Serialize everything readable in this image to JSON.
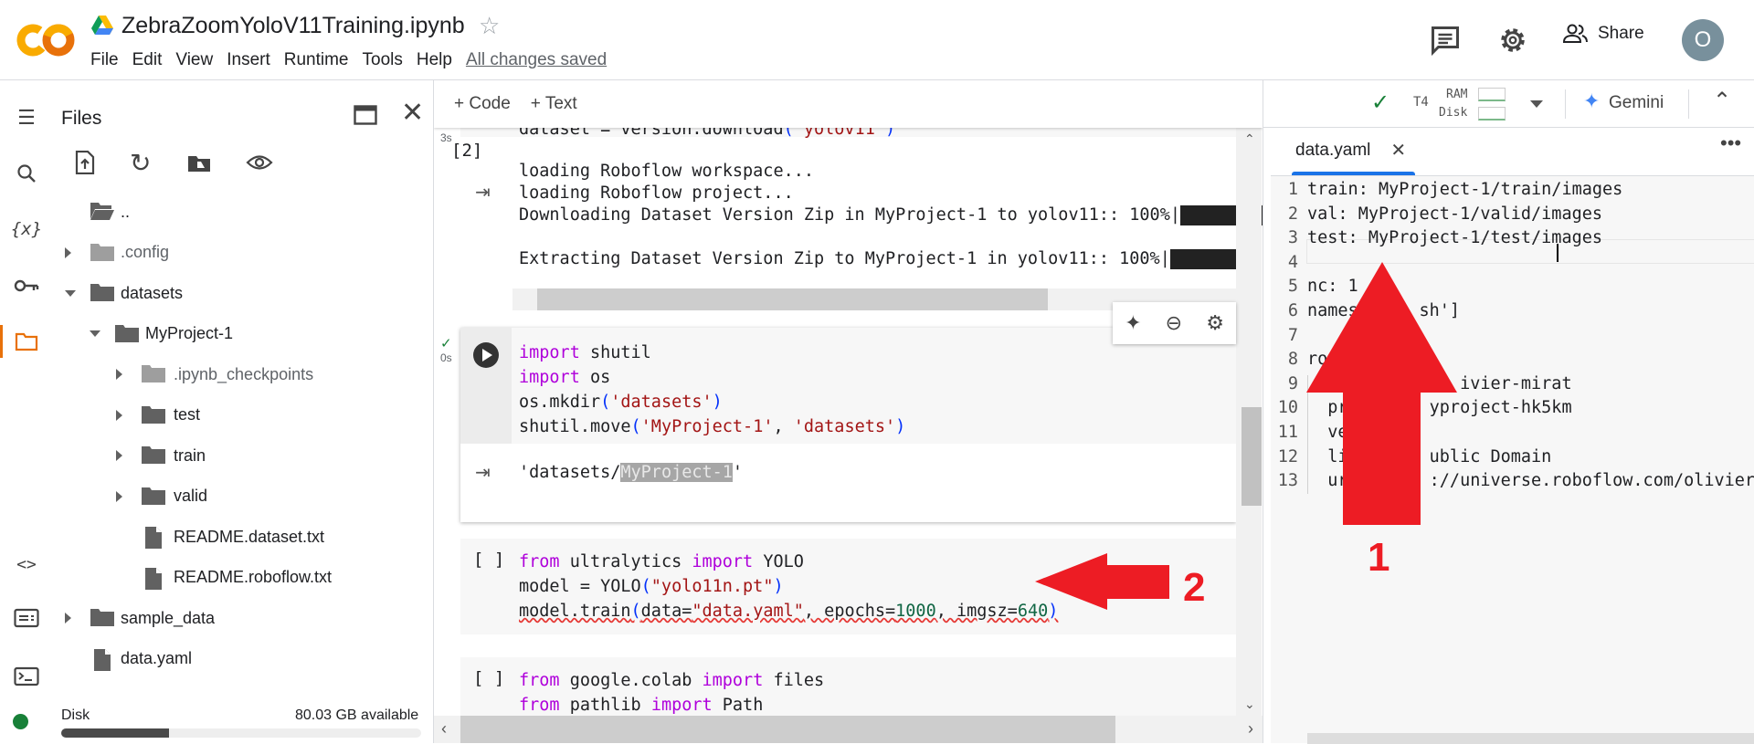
{
  "header": {
    "title": "ZebraZoomYoloV11Training.ipynb",
    "menu": [
      "File",
      "Edit",
      "View",
      "Insert",
      "Runtime",
      "Tools",
      "Help"
    ],
    "save_status": "All changes saved",
    "share_label": "Share",
    "avatar_initial": "O"
  },
  "rail": {
    "icons": [
      "toc-icon",
      "search-icon",
      "variables-icon",
      "key-icon",
      "folder-icon",
      "code-snippets-icon",
      "command-palette-icon",
      "terminal-icon"
    ],
    "active": "folder-icon"
  },
  "files": {
    "title": "Files",
    "tree": [
      {
        "label": "..",
        "level": 0,
        "kind": "folder-open"
      },
      {
        "label": ".config",
        "level": 0,
        "kind": "folder",
        "chevron": "right",
        "hidden": true
      },
      {
        "label": "datasets",
        "level": 0,
        "kind": "folder",
        "chevron": "down"
      },
      {
        "label": "MyProject-1",
        "level": 1,
        "kind": "folder",
        "chevron": "down"
      },
      {
        "label": ".ipynb_checkpoints",
        "level": 2,
        "kind": "folder",
        "chevron": "right",
        "hidden": true
      },
      {
        "label": "test",
        "level": 2,
        "kind": "folder",
        "chevron": "right"
      },
      {
        "label": "train",
        "level": 2,
        "kind": "folder",
        "chevron": "right"
      },
      {
        "label": "valid",
        "level": 2,
        "kind": "folder",
        "chevron": "right"
      },
      {
        "label": "README.dataset.txt",
        "level": 2,
        "kind": "file"
      },
      {
        "label": "README.roboflow.txt",
        "level": 2,
        "kind": "file"
      },
      {
        "label": "sample_data",
        "level": 0,
        "kind": "folder",
        "chevron": "right"
      },
      {
        "label": "data.yaml",
        "level": 0,
        "kind": "file"
      }
    ],
    "disk_label": "Disk",
    "disk_available": "80.03 GB available",
    "disk_used_fraction": 0.3
  },
  "toolbar": {
    "add_code": "+ Code",
    "add_text": "+ Text",
    "runtime": "T4",
    "ram_label": "RAM",
    "disk_label": "Disk",
    "gemini_label": "Gemini",
    "status_color": "#188038"
  },
  "cells": [
    {
      "exec": "[2]",
      "time": "3s",
      "status": "done",
      "code": [
        [
          [
            "dataset = version.download",
            ""
          ],
          [
            "(",
            "par"
          ],
          [
            "\"yolov11\"",
            "str"
          ],
          [
            ")",
            "par"
          ]
        ]
      ],
      "output": [
        "loading Roboflow workspace...",
        "loading Roboflow project...",
        "Downloading Dataset Version Zip in MyProject-1 to yolov11:: 100%|",
        "",
        "Extracting Dataset Version Zip to MyProject-1 in yolov11:: 100%|"
      ]
    },
    {
      "exec": "",
      "time": "0s",
      "status": "done",
      "code": [
        [
          [
            "import",
            "kw"
          ],
          [
            " shutil",
            ""
          ]
        ],
        [
          [
            "import",
            "kw"
          ],
          [
            " os",
            ""
          ]
        ],
        [
          [
            "os.mkdir",
            ""
          ],
          [
            "(",
            "par"
          ],
          [
            "'datasets'",
            "str"
          ],
          [
            ")",
            "par"
          ]
        ],
        [
          [
            "shutil.move",
            ""
          ],
          [
            "(",
            "par"
          ],
          [
            "'MyProject-1'",
            "str"
          ],
          [
            ", ",
            ""
          ],
          [
            "'datasets'",
            "str"
          ],
          [
            ")",
            "par"
          ]
        ]
      ],
      "output_prefix": "'datasets/",
      "output_selected": "MyProject-1",
      "output_suffix": "'"
    },
    {
      "exec": "[ ]",
      "code": [
        [
          [
            "from",
            "kw"
          ],
          [
            " ultralytics ",
            ""
          ],
          [
            "import",
            "kw"
          ],
          [
            " YOLO",
            ""
          ]
        ],
        [
          [
            "model = YOLO",
            ""
          ],
          [
            "(",
            "par"
          ],
          [
            "\"yolo11n.pt\"",
            "str"
          ],
          [
            ")",
            "par"
          ]
        ],
        [
          [
            "model.train",
            ""
          ],
          [
            "(",
            "par"
          ],
          [
            "data=",
            ""
          ],
          [
            "\"data.yaml\"",
            "str"
          ],
          [
            ", epochs=",
            ""
          ],
          [
            "1000",
            "num"
          ],
          [
            ", imgsz=",
            ""
          ],
          [
            "640",
            "num"
          ],
          [
            ")",
            "par"
          ]
        ]
      ]
    },
    {
      "exec": "[ ]",
      "code": [
        [
          [
            "from",
            "kw"
          ],
          [
            " google.colab ",
            ""
          ],
          [
            "import",
            "kw"
          ],
          [
            " files",
            ""
          ]
        ],
        [
          [
            "from",
            "kw"
          ],
          [
            " pathlib ",
            ""
          ],
          [
            "import",
            "kw"
          ],
          [
            " Path",
            ""
          ]
        ]
      ]
    }
  ],
  "editor": {
    "tab": "data.yaml",
    "lines": [
      "train: MyProject-1/train/images",
      "val: MyProject-1/valid/images",
      "test: MyProject-1/test/images",
      "",
      "nc: 1",
      "names      sh']",
      "",
      "ro",
      "               ivier-mirat",
      "  pr        yproject-hk5km",
      "  ve",
      "  li        ublic Domain",
      "  ur        ://universe.roboflow.com/olivier-m"
    ]
  },
  "annotations": {
    "arrow1_label": "1",
    "arrow2_label": "2",
    "color": "#ed1c24"
  }
}
